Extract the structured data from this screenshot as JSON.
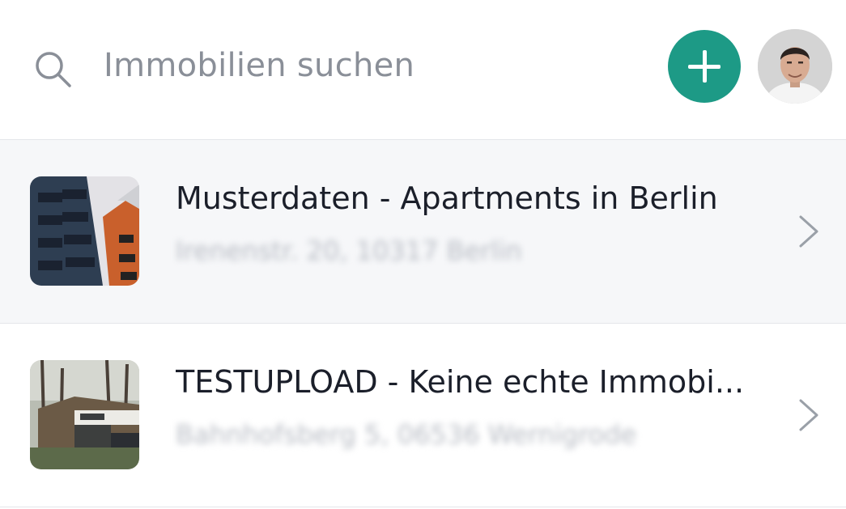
{
  "header": {
    "search": {
      "placeholder": "Immobilien suchen",
      "icon": "search-icon"
    },
    "add_button": {
      "icon": "plus-icon",
      "color": "#1d9a86"
    },
    "avatar": {
      "icon": "user-avatar"
    }
  },
  "properties": [
    {
      "title": "Musterdaten - Apartments in Berlin",
      "address": "Irenenstr. 20, 10317 Berlin",
      "thumbnail": "apartment-building-image"
    },
    {
      "title": "TESTUPLOAD - Keine echte Immobi...",
      "address": "Bahnhofsberg 5, 06536 Wernigrode",
      "thumbnail": "house-image"
    }
  ]
}
